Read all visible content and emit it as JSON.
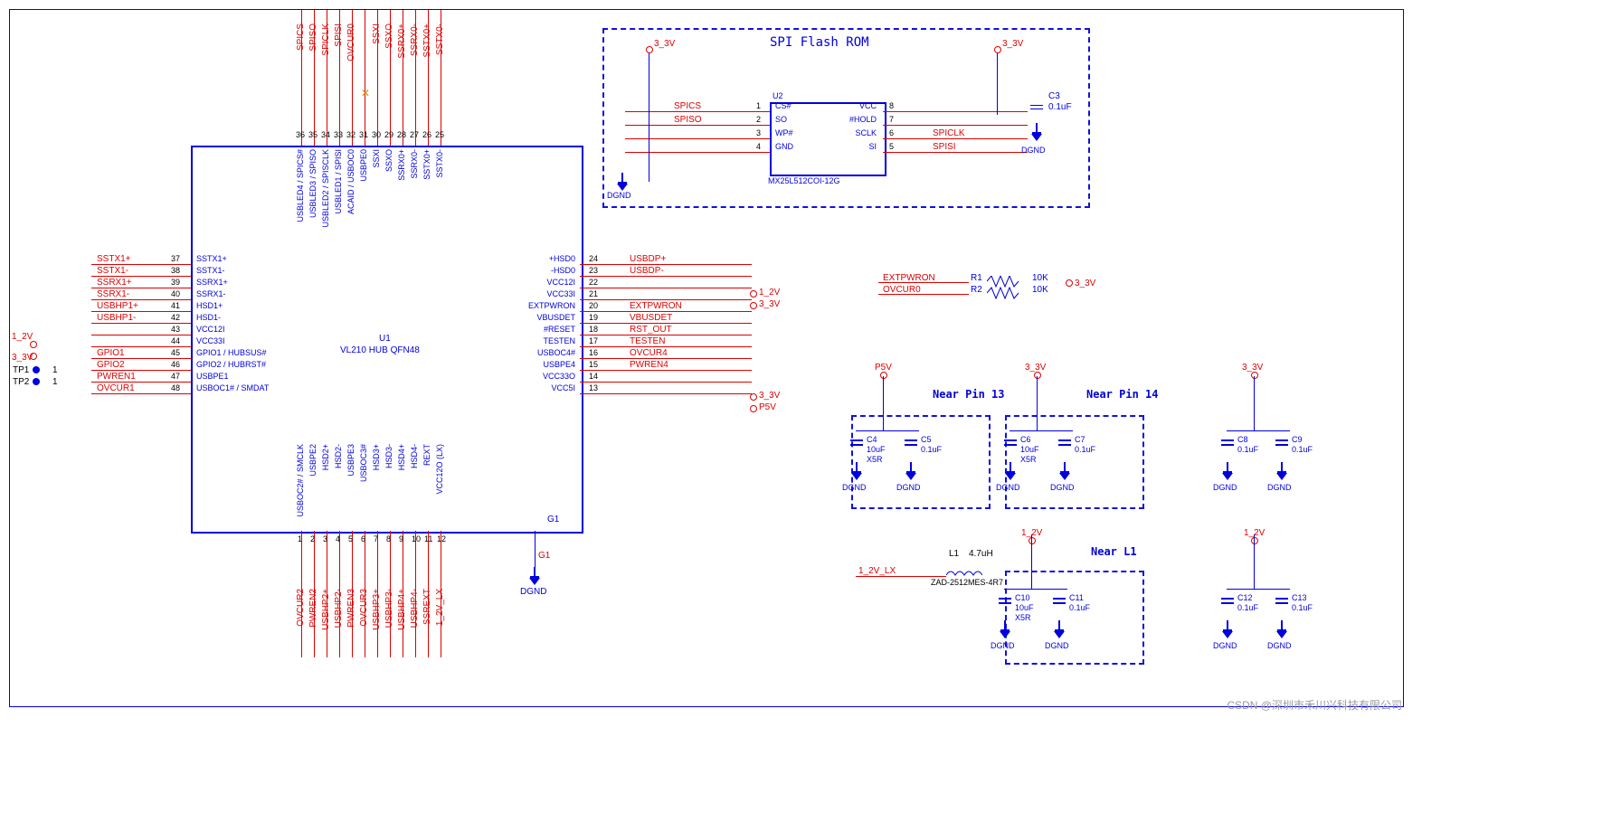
{
  "main_chip": {
    "ref": "U1",
    "part": "VL210 HUB QFN48"
  },
  "flash_chip": {
    "ref": "U2",
    "part": "MX25L512COI-12G",
    "title": "SPI Flash ROM"
  },
  "left_pins": [
    {
      "num": "37",
      "name": "SSTX1+",
      "net": "SSTX1+"
    },
    {
      "num": "38",
      "name": "SSTX1-",
      "net": "SSTX1-"
    },
    {
      "num": "39",
      "name": "SSRX1+",
      "net": "SSRX1+"
    },
    {
      "num": "40",
      "name": "SSRX1-",
      "net": "SSRX1-"
    },
    {
      "num": "41",
      "name": "HSD1+",
      "net": "USBHP1+"
    },
    {
      "num": "42",
      "name": "HSD1-",
      "net": "USBHP1-"
    },
    {
      "num": "43",
      "name": "VCC12I",
      "net": ""
    },
    {
      "num": "44",
      "name": "VCC33I",
      "net": ""
    },
    {
      "num": "45",
      "name": "GPIO1 / HUBSUS#",
      "net": "GPIO1"
    },
    {
      "num": "46",
      "name": "GPIO2 / HUBRST#",
      "net": "GPIO2"
    },
    {
      "num": "47",
      "name": "USBPE1",
      "net": "PWREN1"
    },
    {
      "num": "48",
      "name": "USBOC1# / SMDAT",
      "net": "OVCUR1"
    }
  ],
  "right_pins": [
    {
      "num": "24",
      "name": "HSD0+",
      "net": "USBDP+"
    },
    {
      "num": "23",
      "name": "HSD0-",
      "net": "USBDP-"
    },
    {
      "num": "22",
      "name": "VCC12I",
      "net": ""
    },
    {
      "num": "21",
      "name": "VCC33I",
      "net": ""
    },
    {
      "num": "20",
      "name": "EXTPWRON",
      "net": "EXTPWRON"
    },
    {
      "num": "19",
      "name": "VBUSDET",
      "net": "VBUSDET"
    },
    {
      "num": "18",
      "name": "RESET#",
      "net": "RST_OUT"
    },
    {
      "num": "17",
      "name": "TESTEN",
      "net": "TESTEN"
    },
    {
      "num": "16",
      "name": "USBOC4#",
      "net": "OVCUR4"
    },
    {
      "num": "15",
      "name": "USBPE4",
      "net": "PWREN4"
    },
    {
      "num": "14",
      "name": "VCC33O",
      "net": ""
    },
    {
      "num": "13",
      "name": "VCC5I",
      "net": ""
    }
  ],
  "top_pins": [
    {
      "num": "36",
      "name": "USBLED4 / SPICS#",
      "net": "SPICS"
    },
    {
      "num": "35",
      "name": "USBLED3 / SPISO",
      "net": "SPISO"
    },
    {
      "num": "34",
      "name": "USBLED2 / SPISCLK",
      "net": "SPICLK"
    },
    {
      "num": "33",
      "name": "USBLED1 / SPISI",
      "net": "SPISI"
    },
    {
      "num": "32",
      "name": "ACAID / USBOC0",
      "net": "OVCUR0"
    },
    {
      "num": "31",
      "name": "USBPE0",
      "net": ""
    },
    {
      "num": "30",
      "name": "SSXI",
      "net": "SSXI"
    },
    {
      "num": "29",
      "name": "SSXO",
      "net": "SSXO"
    },
    {
      "num": "28",
      "name": "SSRX0+",
      "net": "SSRX0+"
    },
    {
      "num": "27",
      "name": "SSRX0-",
      "net": "SSRX0-"
    },
    {
      "num": "26",
      "name": "SSTX0+",
      "net": "SSTX0+"
    },
    {
      "num": "25",
      "name": "SSTX0-",
      "net": "SSTX0-"
    }
  ],
  "bottom_pins": [
    {
      "num": "1",
      "name": "USBOC2# / SMCLK",
      "net": "OVCUR2"
    },
    {
      "num": "2",
      "name": "USBPE2",
      "net": "PWREN2"
    },
    {
      "num": "3",
      "name": "HSD2+",
      "net": "USBHP2+"
    },
    {
      "num": "4",
      "name": "HSD2-",
      "net": "USBHP2-"
    },
    {
      "num": "5",
      "name": "USBPE3",
      "net": "PWREN3"
    },
    {
      "num": "6",
      "name": "USBOC3#",
      "net": "OVCUR3"
    },
    {
      "num": "7",
      "name": "HSD3+",
      "net": "USBHP3+"
    },
    {
      "num": "8",
      "name": "HSD3-",
      "net": "USBHP3-"
    },
    {
      "num": "9",
      "name": "HSD4+",
      "net": "USBHP4+"
    },
    {
      "num": "10",
      "name": "HSD4-",
      "net": "USBHP4-"
    },
    {
      "num": "11",
      "name": "REXT",
      "net": "SSREXT"
    },
    {
      "num": "12",
      "name": "VCC12O (LX)",
      "net": "1_2V_LX"
    }
  ],
  "u1_g1": {
    "pin": "G1",
    "net": "G1"
  },
  "u2_pins": {
    "left": [
      {
        "num": "1",
        "name": "CS#",
        "net": "SPICS"
      },
      {
        "num": "2",
        "name": "SO",
        "net": "SPISO"
      },
      {
        "num": "3",
        "name": "WP#",
        "net": ""
      },
      {
        "num": "4",
        "name": "GND",
        "net": ""
      }
    ],
    "right": [
      {
        "num": "8",
        "name": "VCC",
        "net": ""
      },
      {
        "num": "7",
        "name": "HOLD#",
        "net": ""
      },
      {
        "num": "6",
        "name": "SCLK",
        "net": "SPICLK"
      },
      {
        "num": "5",
        "name": "SI",
        "net": "SPISI"
      }
    ]
  },
  "resistors": {
    "r1": {
      "ref": "R1",
      "val": "10K",
      "net": "EXTPWRON"
    },
    "r2": {
      "ref": "R2",
      "val": "10K",
      "net": "OVCUR0"
    }
  },
  "inductor": {
    "ref": "L1",
    "val": "4.7uH",
    "part": "ZAD-2512MES-4R7",
    "net": "1_2V_LX"
  },
  "caps": {
    "c3": {
      "ref": "C3",
      "val": "0.1uF"
    },
    "c4": {
      "ref": "C4",
      "val": "10uF",
      "note": "X5R"
    },
    "c5": {
      "ref": "C5",
      "val": "0.1uF"
    },
    "c6": {
      "ref": "C6",
      "val": "10uF",
      "note": "X5R"
    },
    "c7": {
      "ref": "C7",
      "val": "0.1uF"
    },
    "c8": {
      "ref": "C8",
      "val": "0.1uF"
    },
    "c9": {
      "ref": "C9",
      "val": "0.1uF"
    },
    "c10": {
      "ref": "C10",
      "val": "10uF",
      "note": "X5R"
    },
    "c11": {
      "ref": "C11",
      "val": "0.1uF"
    },
    "c12": {
      "ref": "C12",
      "val": "0.1uF"
    },
    "c13": {
      "ref": "C13",
      "val": "0.1uF"
    }
  },
  "power_labels": {
    "p1_2v": "1_2V",
    "p3_3v": "3_3V",
    "p5v": "P5V",
    "dgnd": "DGND"
  },
  "annotations": {
    "near13": "Near Pin 13",
    "near14": "Near Pin 14",
    "nearL1": "Near L1"
  },
  "testpoints": {
    "tp1": "TP1",
    "tp2": "TP2",
    "val": "1"
  },
  "watermark": "CSDN @深圳市禾川兴科技有限公司"
}
